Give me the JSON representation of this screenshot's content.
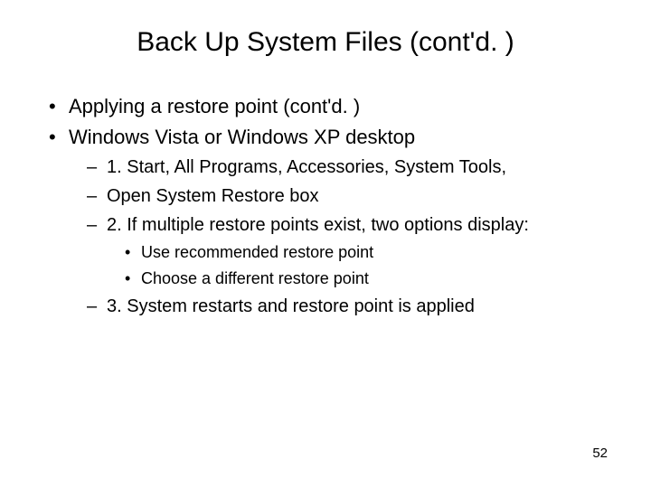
{
  "title": "Back Up System Files (cont'd. )",
  "bullets": {
    "l1_0": "Applying a restore point (cont'd. )",
    "l1_1": "Windows Vista or Windows XP desktop",
    "l2_0": "1. Start, All Programs, Accessories, System Tools,",
    "l2_1": " Open System Restore box",
    "l2_2": "2. If multiple restore points exist, two options display:",
    "l3_0": "Use recommended restore point",
    "l3_1": "Choose a different restore point",
    "l2_3": "3. System restarts and restore point is applied"
  },
  "page_number": "52"
}
